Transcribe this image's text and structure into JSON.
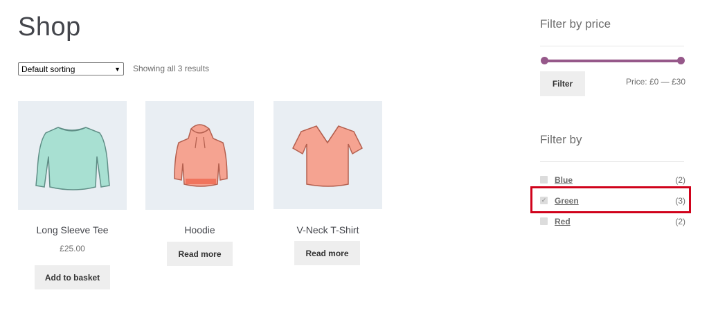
{
  "page": {
    "title": "Shop"
  },
  "sorting": {
    "selected": "Default sorting"
  },
  "results": {
    "text": "Showing all 3 results"
  },
  "products": [
    {
      "name": "Long Sleeve Tee",
      "price": "£25.00",
      "button": "Add to basket",
      "image": "long-sleeve-tee-image"
    },
    {
      "name": "Hoodie",
      "price": "",
      "button": "Read more",
      "image": "hoodie-image"
    },
    {
      "name": "V-Neck T-Shirt",
      "price": "",
      "button": "Read more",
      "image": "v-neck-tshirt-image"
    }
  ],
  "price_filter": {
    "title": "Filter by price",
    "button": "Filter",
    "label": "Price: £0 — £30",
    "accent_color": "#96588a"
  },
  "attribute_filter": {
    "title": "Filter by",
    "items": [
      {
        "name": "Blue",
        "count": "(2)",
        "checked": false
      },
      {
        "name": "Green",
        "count": "(3)",
        "checked": true
      },
      {
        "name": "Red",
        "count": "(2)",
        "checked": false
      }
    ],
    "highlight_color": "#d0021b"
  }
}
